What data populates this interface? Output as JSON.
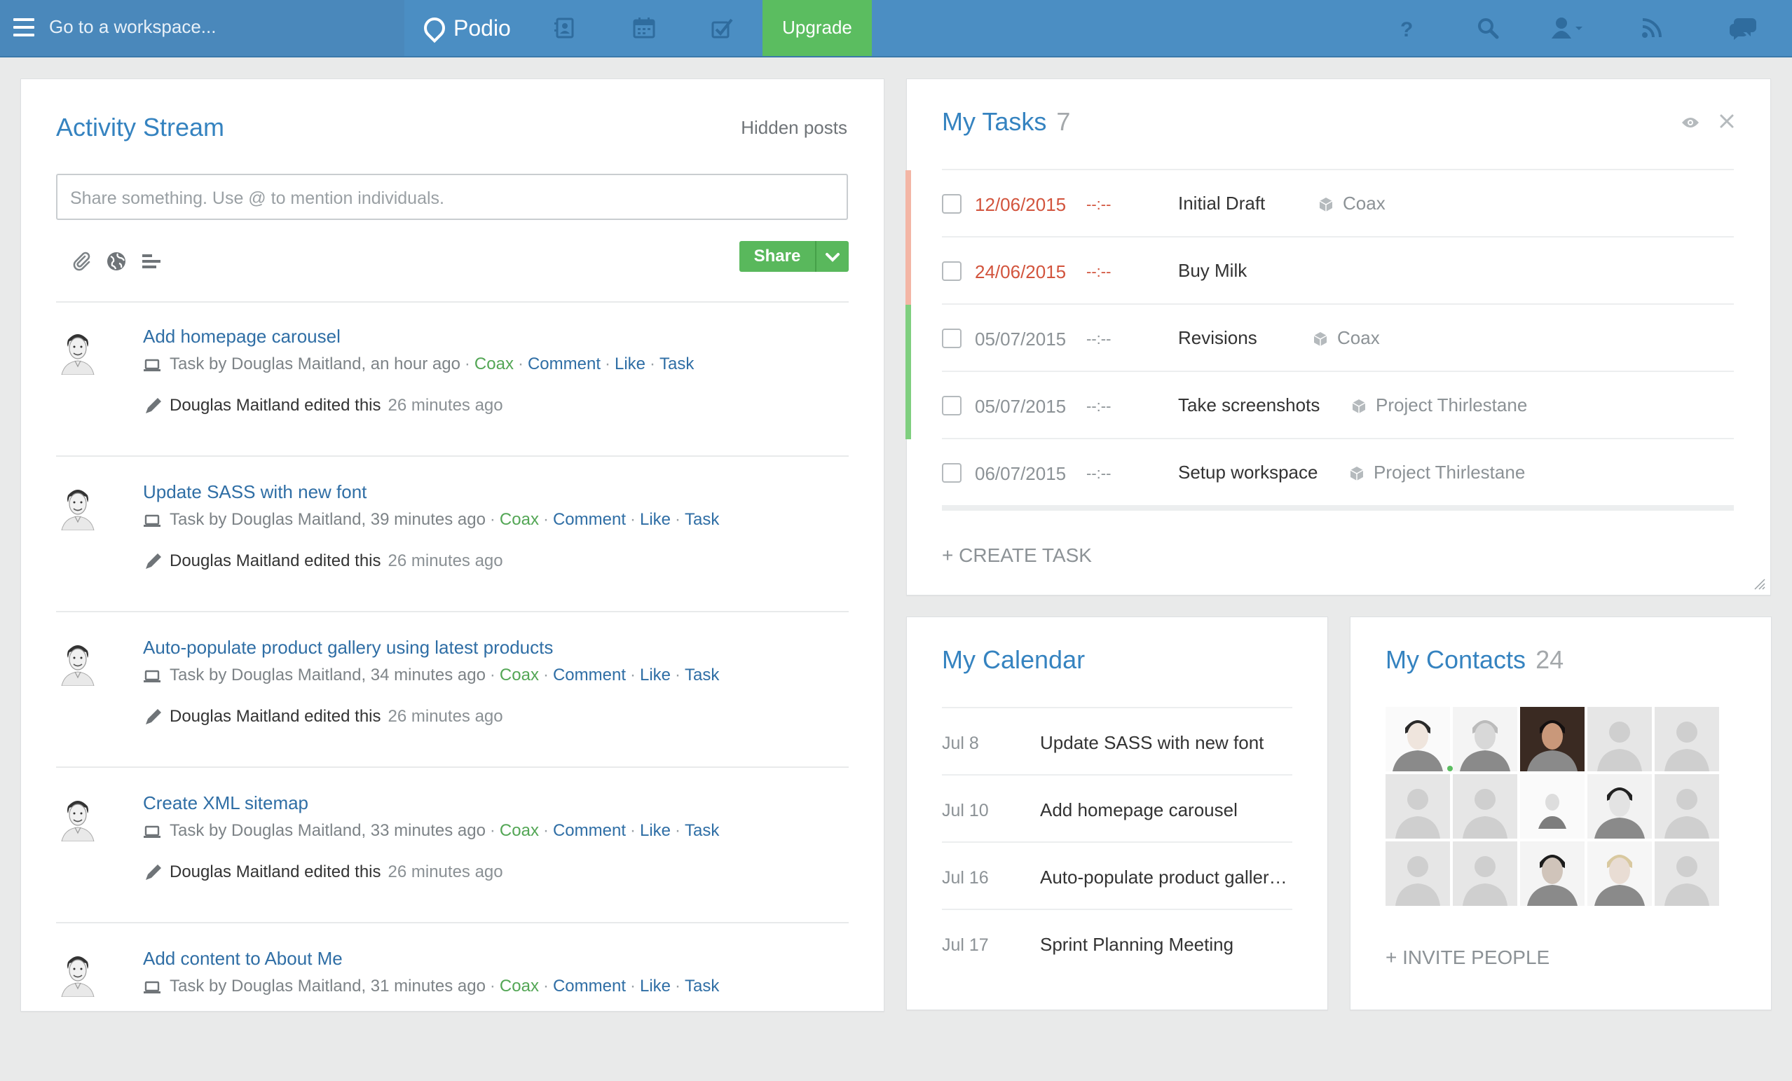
{
  "topbar": {
    "workspace_placeholder": "Go to a workspace...",
    "brand": "Podio",
    "upgrade_label": "Upgrade",
    "colors": {
      "bar": "#4b8ec3",
      "upgrade": "#5bbd60"
    }
  },
  "stream": {
    "title": "Activity Stream",
    "hidden_posts": "Hidden posts",
    "share_placeholder": "Share something. Use @ to mention individuals.",
    "share_label": "Share",
    "posts": [
      {
        "title": "Add homepage carousel",
        "meta": "Task by Douglas Maitland, an hour ago",
        "workspace": "Coax",
        "comment": "Comment",
        "like": "Like",
        "task": "Task",
        "edit_by": "Douglas Maitland edited this",
        "edit_ago": "26 minutes ago"
      },
      {
        "title": "Update SASS with new font",
        "meta": "Task by Douglas Maitland, 39 minutes ago",
        "workspace": "Coax",
        "comment": "Comment",
        "like": "Like",
        "task": "Task",
        "edit_by": "Douglas Maitland edited this",
        "edit_ago": "26 minutes ago"
      },
      {
        "title": "Auto-populate product gallery using latest products",
        "meta": "Task by Douglas Maitland, 34 minutes ago",
        "workspace": "Coax",
        "comment": "Comment",
        "like": "Like",
        "task": "Task",
        "edit_by": "Douglas Maitland edited this",
        "edit_ago": "26 minutes ago"
      },
      {
        "title": "Create XML sitemap",
        "meta": "Task by Douglas Maitland, 33 minutes ago",
        "workspace": "Coax",
        "comment": "Comment",
        "like": "Like",
        "task": "Task",
        "edit_by": "Douglas Maitland edited this",
        "edit_ago": "26 minutes ago"
      },
      {
        "title": "Add content to About Me",
        "meta": "Task by Douglas Maitland, 31 minutes ago",
        "workspace": "Coax",
        "comment": "Comment",
        "like": "Like",
        "task": "Task"
      }
    ]
  },
  "tasks": {
    "title": "My Tasks",
    "count": "7",
    "create_label": "+ CREATE TASK",
    "items": [
      {
        "date": "12/06/2015",
        "time": "--:--",
        "name": "Initial Draft",
        "space": "Coax",
        "overdue": true,
        "bar": "#f3b6a5"
      },
      {
        "date": "24/06/2015",
        "time": "--:--",
        "name": "Buy Milk",
        "space": "",
        "overdue": true,
        "bar": "#f3b6a5"
      },
      {
        "date": "05/07/2015",
        "time": "--:--",
        "name": "Revisions",
        "space": "Coax",
        "overdue": false,
        "bar": "#7fcf7f"
      },
      {
        "date": "05/07/2015",
        "time": "--:--",
        "name": "Take screenshots",
        "space": "Project Thirlestane",
        "overdue": false,
        "bar": "#7fcf7f"
      },
      {
        "date": "06/07/2015",
        "time": "--:--",
        "name": "Setup workspace",
        "space": "Project Thirlestane",
        "overdue": false,
        "bar": ""
      }
    ]
  },
  "calendar": {
    "title": "My Calendar",
    "events": [
      {
        "date": "Jul 8",
        "name": "Update SASS with new font"
      },
      {
        "date": "Jul 10",
        "name": "Add homepage carousel"
      },
      {
        "date": "Jul 16",
        "name": "Auto-populate product galler…"
      },
      {
        "date": "Jul 17",
        "name": "Sprint Planning Meeting"
      }
    ]
  },
  "contacts": {
    "title": "My Contacts",
    "count": "24",
    "invite_label": "+ INVITE PEOPLE"
  }
}
